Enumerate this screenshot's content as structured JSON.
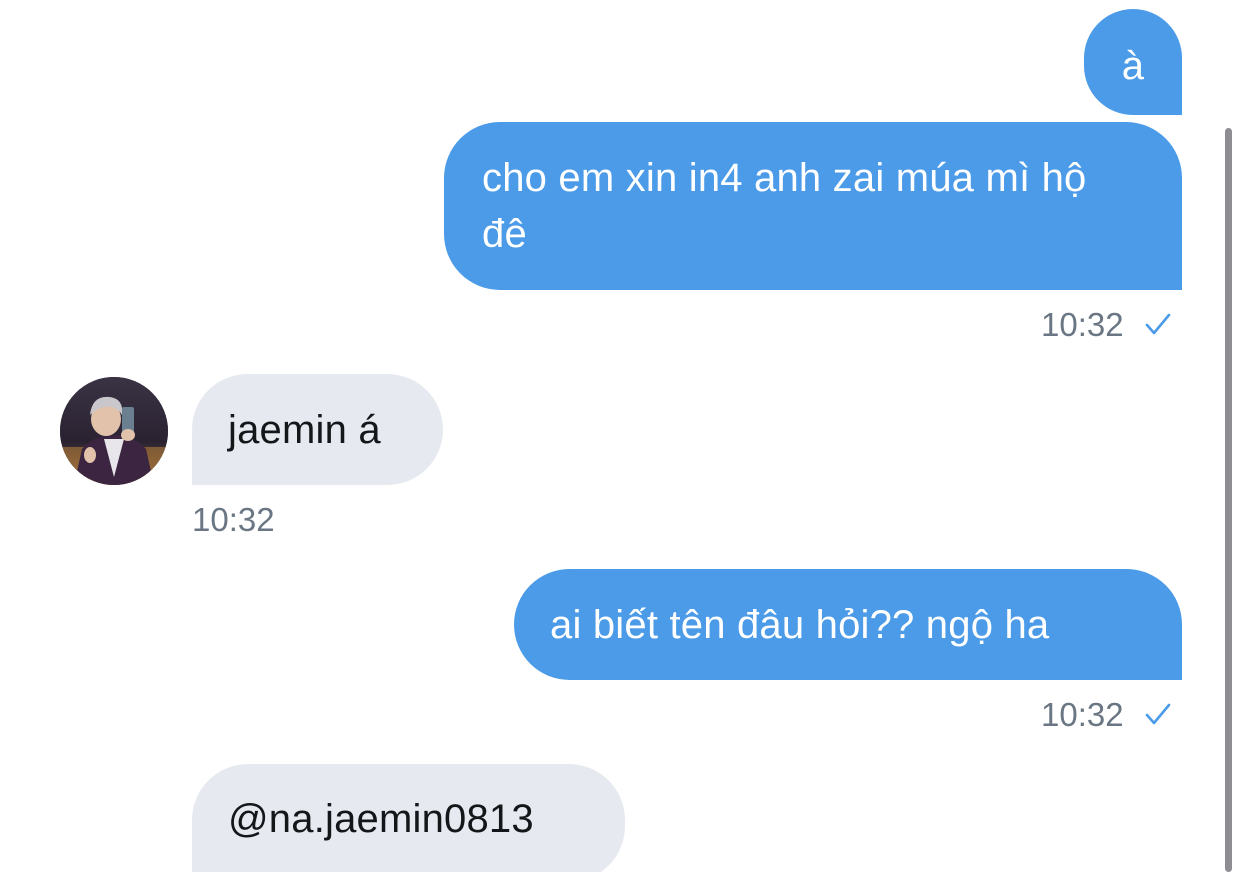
{
  "conversation": {
    "messages": [
      {
        "direction": "outgoing",
        "text": "à"
      },
      {
        "direction": "outgoing",
        "text": "cho em xin in4 anh zai múa mì hộ đê",
        "time": "10:32",
        "read": true
      },
      {
        "direction": "incoming",
        "text": "jaemin á",
        "time": "10:32"
      },
      {
        "direction": "outgoing",
        "text": "ai biết tên đâu hỏi?? ngộ ha",
        "time": "10:32",
        "read": true
      },
      {
        "direction": "incoming",
        "text": "@na.jaemin0813"
      }
    ]
  },
  "colors": {
    "outgoing_bubble": "#4b9be8",
    "incoming_bubble": "#e6e9f0",
    "timestamp": "#6a7683",
    "read_check": "#4b9be8"
  },
  "icons": {
    "read_receipt": "checkmark-icon",
    "contact": "avatar"
  }
}
